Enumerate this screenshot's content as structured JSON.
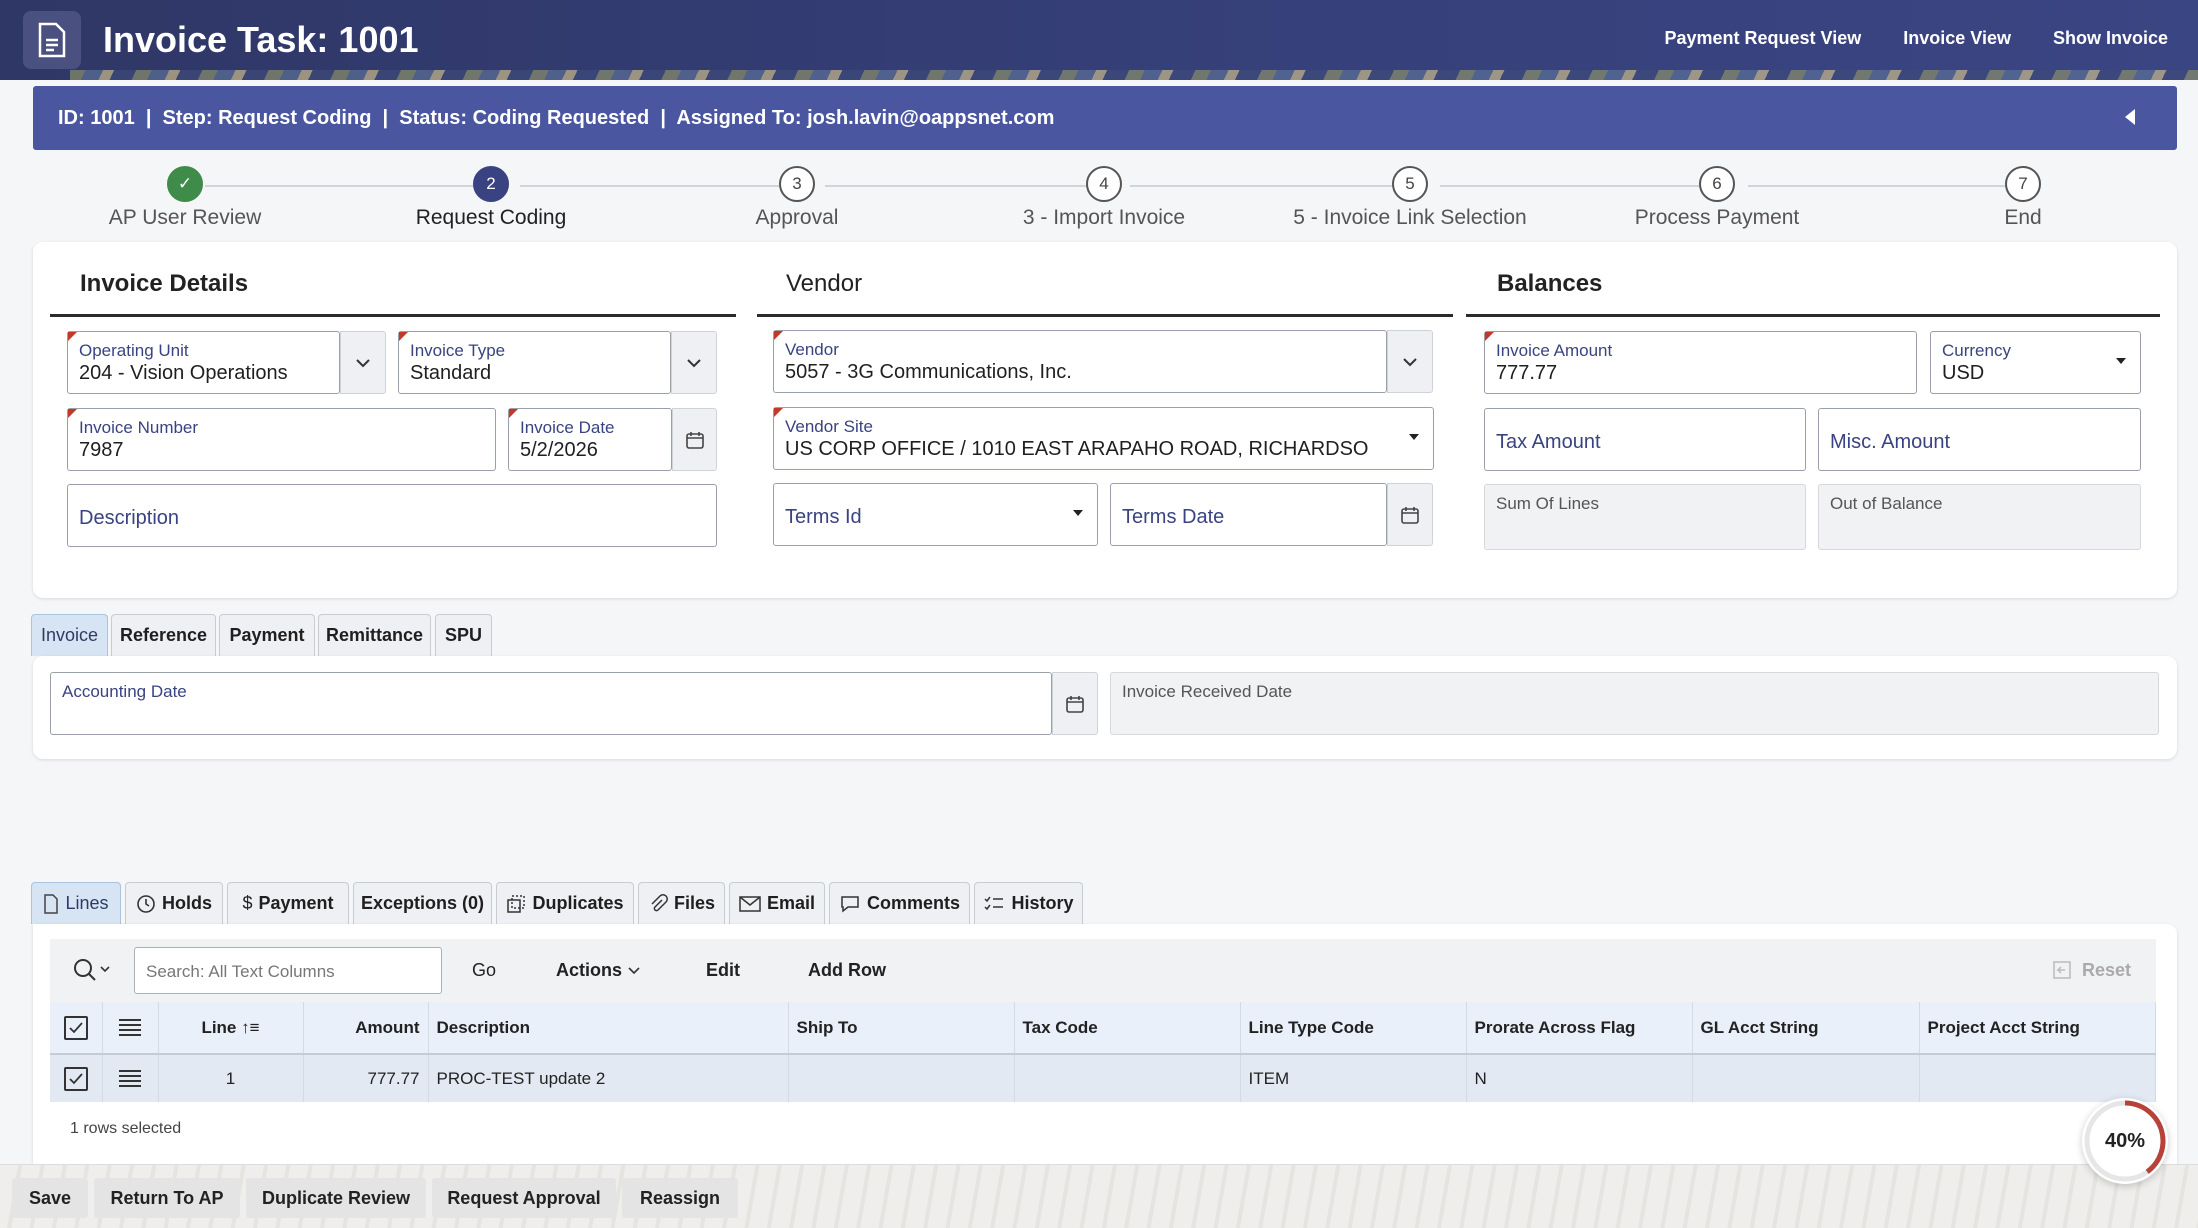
{
  "header": {
    "title": "Invoice Task: 1001",
    "buttons": [
      "Payment Request View",
      "Invoice View",
      "Show Invoice"
    ]
  },
  "info_bar": {
    "text": "ID: 1001  |  Step: Request Coding  |  Status: Coding Requested  |  Assigned To: josh.lavin@oappsnet.com"
  },
  "stepper": {
    "steps": [
      {
        "num": "✓",
        "label": "AP User Review",
        "state": "done"
      },
      {
        "num": "2",
        "label": "Request Coding",
        "state": "current"
      },
      {
        "num": "3",
        "label": "Approval",
        "state": "pending"
      },
      {
        "num": "4",
        "label": "3 - Import Invoice",
        "state": "pending"
      },
      {
        "num": "5",
        "label": "5 - Invoice Link Selection",
        "state": "pending"
      },
      {
        "num": "6",
        "label": "Process Payment",
        "state": "pending"
      },
      {
        "num": "7",
        "label": "End",
        "state": "pending"
      }
    ]
  },
  "invoice_details": {
    "title": "Invoice Details",
    "operating_unit": {
      "label": "Operating Unit",
      "value": "204 - Vision Operations"
    },
    "invoice_type": {
      "label": "Invoice Type",
      "value": "Standard"
    },
    "invoice_number": {
      "label": "Invoice Number",
      "value": "7987"
    },
    "invoice_date": {
      "label": "Invoice Date",
      "value": "5/2/2026"
    },
    "description": {
      "placeholder": "Description"
    }
  },
  "vendor": {
    "title": "Vendor",
    "vendor": {
      "label": "Vendor",
      "value": "5057 - 3G Communications, Inc."
    },
    "vendor_site": {
      "label": "Vendor Site",
      "value": "US CORP OFFICE / 1010 EAST ARAPAHO ROAD, RICHARDSO"
    },
    "terms_id": {
      "placeholder": "Terms Id"
    },
    "terms_date": {
      "placeholder": "Terms Date"
    }
  },
  "balances": {
    "title": "Balances",
    "invoice_amount": {
      "label": "Invoice Amount",
      "value": "777.77"
    },
    "currency": {
      "label": "Currency",
      "value": "USD"
    },
    "tax_amount": {
      "placeholder": "Tax Amount"
    },
    "misc_amount": {
      "placeholder": "Misc. Amount"
    },
    "sum_of_lines": {
      "label": "Sum Of Lines"
    },
    "out_of_balance": {
      "label": "Out of Balance"
    }
  },
  "detail_tabs": [
    "Invoice",
    "Reference",
    "Payment",
    "Remittance",
    "SPU"
  ],
  "invoice_tab": {
    "accounting_date": {
      "label": "Accounting Date"
    },
    "invoice_received_date": {
      "label": "Invoice Received Date"
    }
  },
  "lower_tabs": [
    {
      "label": "Lines",
      "icon": "document-icon"
    },
    {
      "label": "Holds",
      "icon": "clock-icon"
    },
    {
      "label": "Payment",
      "icon": "dollar-icon"
    },
    {
      "label": "Exceptions (0)",
      "icon": ""
    },
    {
      "label": "Duplicates",
      "icon": "duplicate-icon"
    },
    {
      "label": "Files",
      "icon": "paperclip-icon"
    },
    {
      "label": "Email",
      "icon": "envelope-icon"
    },
    {
      "label": "Comments",
      "icon": "comment-icon"
    },
    {
      "label": "History",
      "icon": "checklist-icon"
    }
  ],
  "grid_toolbar": {
    "search_placeholder": "Search: All Text Columns",
    "go": "Go",
    "actions": "Actions",
    "edit": "Edit",
    "add_row": "Add Row",
    "reset": "Reset"
  },
  "grid": {
    "columns": [
      "Line",
      "Amount",
      "Description",
      "Ship To",
      "Tax Code",
      "Line Type Code",
      "Prorate Across Flag",
      "GL Acct String",
      "Project Acct String"
    ],
    "rows": [
      [
        "1",
        "777.77",
        "PROC-TEST update 2",
        "",
        "",
        "ITEM",
        "N",
        "",
        ""
      ]
    ],
    "footer": "1 rows selected"
  },
  "bottom_buttons": [
    "Save",
    "Return To AP",
    "Duplicate Review",
    "Request Approval",
    "Reassign"
  ],
  "progress": {
    "value": 40,
    "label": "40%"
  }
}
